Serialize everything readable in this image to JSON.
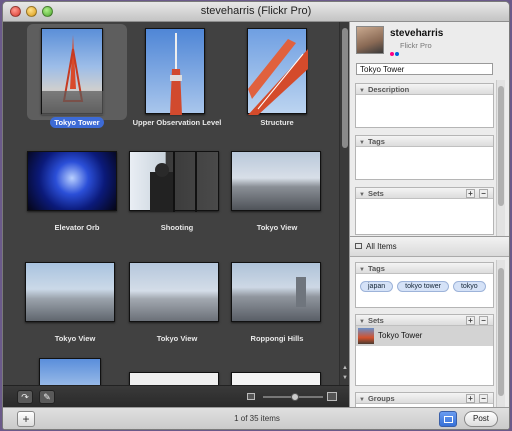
{
  "window": {
    "title": "steveharris (Flickr Pro)"
  },
  "photos": [
    {
      "caption": "Tokyo Tower",
      "selected": true
    },
    {
      "caption": "Upper Observation Level",
      "selected": false
    },
    {
      "caption": "Structure",
      "selected": false
    },
    {
      "caption": "Elevator Orb",
      "selected": false
    },
    {
      "caption": "Shooting",
      "selected": false
    },
    {
      "caption": "Tokyo View",
      "selected": false
    },
    {
      "caption": "Tokyo View",
      "selected": false
    },
    {
      "caption": "Tokyo View",
      "selected": false
    },
    {
      "caption": "Roppongi Hills",
      "selected": false
    }
  ],
  "status": {
    "count_text": "1 of 35 items",
    "post_label": "Post",
    "add_label": "+"
  },
  "sidebar": {
    "username": "steveharris",
    "account_type": "Flickr Pro",
    "photo_title": "Tokyo Tower",
    "description_label": "Description",
    "tags_label": "Tags",
    "sets_label": "Sets",
    "all_items_label": "All Items",
    "all_tags_label": "Tags",
    "all_tags": [
      "japan",
      "tokyo tower",
      "tokyo"
    ],
    "all_sets_label": "Sets",
    "all_sets_item": "Tokyo Tower",
    "groups_label": "Groups"
  },
  "colors": {
    "grid_bg": "#414141",
    "selection": "#3d6bd6",
    "flickr_blue": "#0063dc",
    "flickr_pink": "#ff0084"
  }
}
